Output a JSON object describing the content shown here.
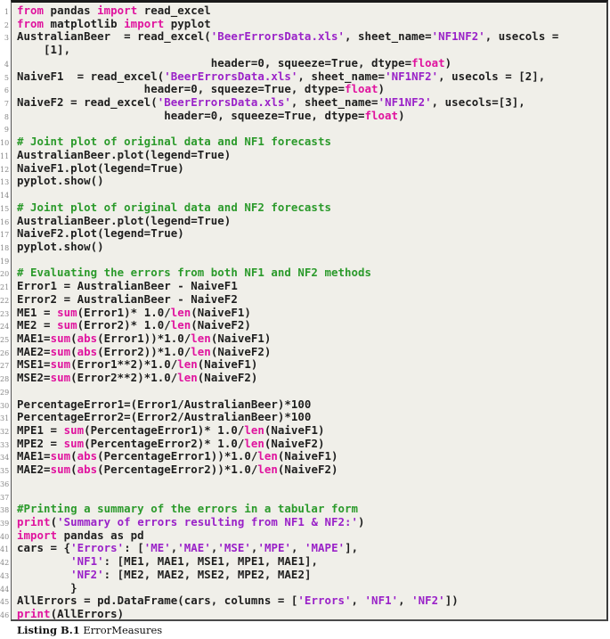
{
  "listing": {
    "caption_label": "Listing B.1",
    "caption_title": "ErrorMeasures",
    "colors": {
      "keyword": "#e0139e",
      "string": "#9a22c8",
      "comment": "#2b9a2b",
      "text": "#1e1e1e",
      "background": "#f0efe9"
    },
    "lines": [
      {
        "n": "1",
        "tokens": [
          [
            "kw",
            "from"
          ],
          [
            "t",
            " pandas "
          ],
          [
            "kw",
            "import"
          ],
          [
            "t",
            " read_excel"
          ]
        ]
      },
      {
        "n": "2",
        "tokens": [
          [
            "kw",
            "from"
          ],
          [
            "t",
            " matplotlib "
          ],
          [
            "kw",
            "import"
          ],
          [
            "t",
            " pyplot"
          ]
        ]
      },
      {
        "n": "3",
        "tokens": [
          [
            "t",
            "AustralianBeer  = read_excel("
          ],
          [
            "str",
            "'BeerErrorsData.xls'"
          ],
          [
            "t",
            ", sheet_name="
          ],
          [
            "str",
            "'NF1NF2'"
          ],
          [
            "t",
            ", usecols ="
          ]
        ]
      },
      {
        "n": "",
        "tokens": [
          [
            "t",
            "    [1],"
          ]
        ]
      },
      {
        "n": "4",
        "tokens": [
          [
            "t",
            "                             header=0, squeeze=True, dtype="
          ],
          [
            "kw",
            "float"
          ],
          [
            "t",
            ")"
          ]
        ]
      },
      {
        "n": "5",
        "tokens": [
          [
            "t",
            "NaiveF1  = read_excel("
          ],
          [
            "str",
            "'BeerErrorsData.xls'"
          ],
          [
            "t",
            ", sheet_name="
          ],
          [
            "str",
            "'NF1NF2'"
          ],
          [
            "t",
            ", usecols = [2],"
          ]
        ]
      },
      {
        "n": "6",
        "tokens": [
          [
            "t",
            "                   header=0, squeeze=True, dtype="
          ],
          [
            "kw",
            "float"
          ],
          [
            "t",
            ")"
          ]
        ]
      },
      {
        "n": "7",
        "tokens": [
          [
            "t",
            "NaiveF2 = read_excel("
          ],
          [
            "str",
            "'BeerErrorsData.xls'"
          ],
          [
            "t",
            ", sheet_name="
          ],
          [
            "str",
            "'NF1NF2'"
          ],
          [
            "t",
            ", usecols=[3],"
          ]
        ]
      },
      {
        "n": "8",
        "tokens": [
          [
            "t",
            "                      header=0, squeeze=True, dtype="
          ],
          [
            "kw",
            "float"
          ],
          [
            "t",
            ")"
          ]
        ]
      },
      {
        "n": "9",
        "tokens": []
      },
      {
        "n": "10",
        "tokens": [
          [
            "com",
            "# Joint plot of original data and NF1 forecasts"
          ]
        ]
      },
      {
        "n": "11",
        "tokens": [
          [
            "t",
            "AustralianBeer.plot(legend=True)"
          ]
        ]
      },
      {
        "n": "12",
        "tokens": [
          [
            "t",
            "NaiveF1.plot(legend=True)"
          ]
        ]
      },
      {
        "n": "13",
        "tokens": [
          [
            "t",
            "pyplot.show()"
          ]
        ]
      },
      {
        "n": "14",
        "tokens": []
      },
      {
        "n": "15",
        "tokens": [
          [
            "com",
            "# Joint plot of original data and NF2 forecasts"
          ]
        ]
      },
      {
        "n": "16",
        "tokens": [
          [
            "t",
            "AustralianBeer.plot(legend=True)"
          ]
        ]
      },
      {
        "n": "17",
        "tokens": [
          [
            "t",
            "NaiveF2.plot(legend=True)"
          ]
        ]
      },
      {
        "n": "18",
        "tokens": [
          [
            "t",
            "pyplot.show()"
          ]
        ]
      },
      {
        "n": "19",
        "tokens": []
      },
      {
        "n": "20",
        "tokens": [
          [
            "com",
            "# Evaluating the errors from both NF1 and NF2 methods"
          ]
        ]
      },
      {
        "n": "21",
        "tokens": [
          [
            "t",
            "Error1 = AustralianBeer - NaiveF1"
          ]
        ]
      },
      {
        "n": "22",
        "tokens": [
          [
            "t",
            "Error2 = AustralianBeer - NaiveF2"
          ]
        ]
      },
      {
        "n": "23",
        "tokens": [
          [
            "t",
            "ME1 = "
          ],
          [
            "kw",
            "sum"
          ],
          [
            "t",
            "(Error1)* 1.0/"
          ],
          [
            "kw",
            "len"
          ],
          [
            "t",
            "(NaiveF1)"
          ]
        ]
      },
      {
        "n": "24",
        "tokens": [
          [
            "t",
            "ME2 = "
          ],
          [
            "kw",
            "sum"
          ],
          [
            "t",
            "(Error2)* 1.0/"
          ],
          [
            "kw",
            "len"
          ],
          [
            "t",
            "(NaiveF2)"
          ]
        ]
      },
      {
        "n": "25",
        "tokens": [
          [
            "t",
            "MAE1="
          ],
          [
            "kw",
            "sum"
          ],
          [
            "t",
            "("
          ],
          [
            "kw",
            "abs"
          ],
          [
            "t",
            "(Error1))*1.0/"
          ],
          [
            "kw",
            "len"
          ],
          [
            "t",
            "(NaiveF1)"
          ]
        ]
      },
      {
        "n": "26",
        "tokens": [
          [
            "t",
            "MAE2="
          ],
          [
            "kw",
            "sum"
          ],
          [
            "t",
            "("
          ],
          [
            "kw",
            "abs"
          ],
          [
            "t",
            "(Error2))*1.0/"
          ],
          [
            "kw",
            "len"
          ],
          [
            "t",
            "(NaiveF2)"
          ]
        ]
      },
      {
        "n": "27",
        "tokens": [
          [
            "t",
            "MSE1="
          ],
          [
            "kw",
            "sum"
          ],
          [
            "t",
            "(Error1**2)*1.0/"
          ],
          [
            "kw",
            "len"
          ],
          [
            "t",
            "(NaiveF1)"
          ]
        ]
      },
      {
        "n": "28",
        "tokens": [
          [
            "t",
            "MSE2="
          ],
          [
            "kw",
            "sum"
          ],
          [
            "t",
            "(Error2**2)*1.0/"
          ],
          [
            "kw",
            "len"
          ],
          [
            "t",
            "(NaiveF2)"
          ]
        ]
      },
      {
        "n": "29",
        "tokens": []
      },
      {
        "n": "30",
        "tokens": [
          [
            "t",
            "PercentageError1=(Error1/AustralianBeer)*100"
          ]
        ]
      },
      {
        "n": "31",
        "tokens": [
          [
            "t",
            "PercentageError2=(Error2/AustralianBeer)*100"
          ]
        ]
      },
      {
        "n": "32",
        "tokens": [
          [
            "t",
            "MPE1 = "
          ],
          [
            "kw",
            "sum"
          ],
          [
            "t",
            "(PercentageError1)* 1.0/"
          ],
          [
            "kw",
            "len"
          ],
          [
            "t",
            "(NaiveF1)"
          ]
        ]
      },
      {
        "n": "33",
        "tokens": [
          [
            "t",
            "MPE2 = "
          ],
          [
            "kw",
            "sum"
          ],
          [
            "t",
            "(PercentageError2)* 1.0/"
          ],
          [
            "kw",
            "len"
          ],
          [
            "t",
            "(NaiveF2)"
          ]
        ]
      },
      {
        "n": "34",
        "tokens": [
          [
            "t",
            "MAE1="
          ],
          [
            "kw",
            "sum"
          ],
          [
            "t",
            "("
          ],
          [
            "kw",
            "abs"
          ],
          [
            "t",
            "(PercentageError1))*1.0/"
          ],
          [
            "kw",
            "len"
          ],
          [
            "t",
            "(NaiveF1)"
          ]
        ]
      },
      {
        "n": "35",
        "tokens": [
          [
            "t",
            "MAE2="
          ],
          [
            "kw",
            "sum"
          ],
          [
            "t",
            "("
          ],
          [
            "kw",
            "abs"
          ],
          [
            "t",
            "(PercentageError2))*1.0/"
          ],
          [
            "kw",
            "len"
          ],
          [
            "t",
            "(NaiveF2)"
          ]
        ]
      },
      {
        "n": "36",
        "tokens": []
      },
      {
        "n": "37",
        "tokens": []
      },
      {
        "n": "38",
        "tokens": [
          [
            "com",
            "#Printing a summary of the errors in a tabular form"
          ]
        ]
      },
      {
        "n": "39",
        "tokens": [
          [
            "kw",
            "print"
          ],
          [
            "t",
            "("
          ],
          [
            "str",
            "'Summary of errors resulting from NF1 & NF2:'"
          ],
          [
            "t",
            ")"
          ]
        ]
      },
      {
        "n": "40",
        "tokens": [
          [
            "kw",
            "import"
          ],
          [
            "t",
            " pandas as pd"
          ]
        ]
      },
      {
        "n": "41",
        "tokens": [
          [
            "t",
            "cars = {"
          ],
          [
            "str",
            "'Errors'"
          ],
          [
            "t",
            ": ["
          ],
          [
            "str",
            "'ME'"
          ],
          [
            "t",
            ","
          ],
          [
            "str",
            "'MAE'"
          ],
          [
            "t",
            ","
          ],
          [
            "str",
            "'MSE'"
          ],
          [
            "t",
            ","
          ],
          [
            "str",
            "'MPE'"
          ],
          [
            "t",
            ", "
          ],
          [
            "str",
            "'MAPE'"
          ],
          [
            "t",
            "],"
          ]
        ]
      },
      {
        "n": "42",
        "tokens": [
          [
            "t",
            "        "
          ],
          [
            "str",
            "'NF1'"
          ],
          [
            "t",
            ": [ME1, MAE1, MSE1, MPE1, MAE1],"
          ]
        ]
      },
      {
        "n": "43",
        "tokens": [
          [
            "t",
            "        "
          ],
          [
            "str",
            "'NF2'"
          ],
          [
            "t",
            ": [ME2, MAE2, MSE2, MPE2, MAE2]"
          ]
        ]
      },
      {
        "n": "44",
        "tokens": [
          [
            "t",
            "        }"
          ]
        ]
      },
      {
        "n": "45",
        "tokens": [
          [
            "t",
            "AllErrors = pd.DataFrame(cars, columns = ["
          ],
          [
            "str",
            "'Errors'"
          ],
          [
            "t",
            ", "
          ],
          [
            "str",
            "'NF1'"
          ],
          [
            "t",
            ", "
          ],
          [
            "str",
            "'NF2'"
          ],
          [
            "t",
            "])"
          ]
        ]
      },
      {
        "n": "46",
        "tokens": [
          [
            "kw",
            "print"
          ],
          [
            "t",
            "(AllErrors)"
          ]
        ]
      }
    ]
  }
}
